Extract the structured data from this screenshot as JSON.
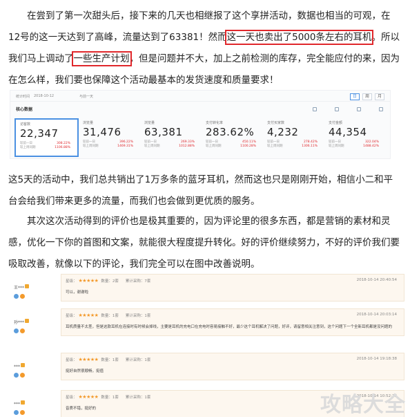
{
  "article": {
    "p1": {
      "a": "　　在尝到了第一次甜头后，接下来的几天也相继报了这个享拼活动，数据也相当的可观，在12号的这一天达到了高峰，流量达到了63381！然而",
      "h1": "这一天也卖出了5000条左右的耳机",
      "b": "。所以我们马上调动了",
      "h2": "一些生产计划",
      "c": "，但是问题并不大，加上之前检测的库存，完全能应付的来，因为在怎么样，我们要也保障这个活动最基本的发货速度和质量要求！"
    },
    "p2": "这5天的活动中，我们总共销出了1万多条的蓝牙耳机，然而这也只是刚刚开始，相信小二和平台会给我们带来更多的流量，而我们也会做到更优质的服务。",
    "p3": "　　其次这次活动得到的评价也是极其重要的，因为评论里的很多东西，都是营销的素材和灵感，优化一下你的首图和文案，就能很大程度提升转化。好的评价继续努力，不好的评价我们要吸取改善，就像以下的评论，我们完全可以在图中改善说明。"
  },
  "stats_panel": {
    "top_label": "统计时间",
    "date_range": "2018-10-12",
    "compare_label": "与前一天",
    "title": "核心数据",
    "controls": [
      "日",
      "周",
      "月"
    ],
    "metrics": [
      {
        "label": "访客数",
        "value": "22,347",
        "row1": "较前一日",
        "pct1": "308.22%",
        "row2": "较上周同期",
        "pct2": "1106.88%"
      },
      {
        "label": "浏览量",
        "value": "31,476",
        "row1": "较前一日",
        "pct1": "396.22%",
        "row2": "较上周同期",
        "pct2": "1469.31%"
      },
      {
        "label": "浏览量",
        "value": "63,381",
        "row1": "较前一日",
        "pct1": "269.33%",
        "row2": "较上周同期",
        "pct2": "1012.88%"
      },
      {
        "label": "支付转化率",
        "value": "283.62%",
        "row1": "较前一日",
        "pct1": "450.11%",
        "row2": "较上周同期",
        "pct2": "1100.28%"
      },
      {
        "label": "支付买家数",
        "value": "4,232",
        "row1": "较前一日",
        "pct1": "278.42%",
        "row2": "较上周同期",
        "pct2": "1306.11%"
      },
      {
        "label": "支付金额",
        "value": "44,354",
        "row1": "较前一日",
        "pct1": "322.04%",
        "row2": "较上周同期",
        "pct2": "1488.42%"
      }
    ]
  },
  "reviews": [
    {
      "user": "王***",
      "rating_label": "星级：",
      "stars": "★★★★★",
      "qty": "数量：2套",
      "deal": "累计采购：7套",
      "time": "2018-10-14 20:40:54",
      "text": "可以，谢谢啦"
    },
    {
      "user": "孙***",
      "rating_label": "星级：",
      "stars": "★★★★★",
      "qty": "数量：1套",
      "deal": "累计采购：1套",
      "time": "2018-10-14 20:03:14",
      "text": "耳机质量不太差，但是这款耳机在连接时有时候会掉线，主要是耳机的充电口在充电时容易接触不好，最少这个耳机解决了问题，好评，请留意相关注意到，这个问题下一个全新耳机都是没问题的"
    },
    {
      "user": "***",
      "rating_label": "星级：",
      "stars": "★★★★★",
      "qty": "数量：1套",
      "deal": "累计采购：1套",
      "time": "2018-10-14 19:18:38",
      "text": "挺好自然很顺畅，挺值"
    },
    {
      "user": "***",
      "rating_label": "星级：",
      "stars": "★★★★★",
      "qty": "数量：1套",
      "deal": "累计采购：1套",
      "time": "2018-10-14 10:52:33",
      "text": "音质不错，挺好的"
    }
  ],
  "watermark": "攻略大全"
}
